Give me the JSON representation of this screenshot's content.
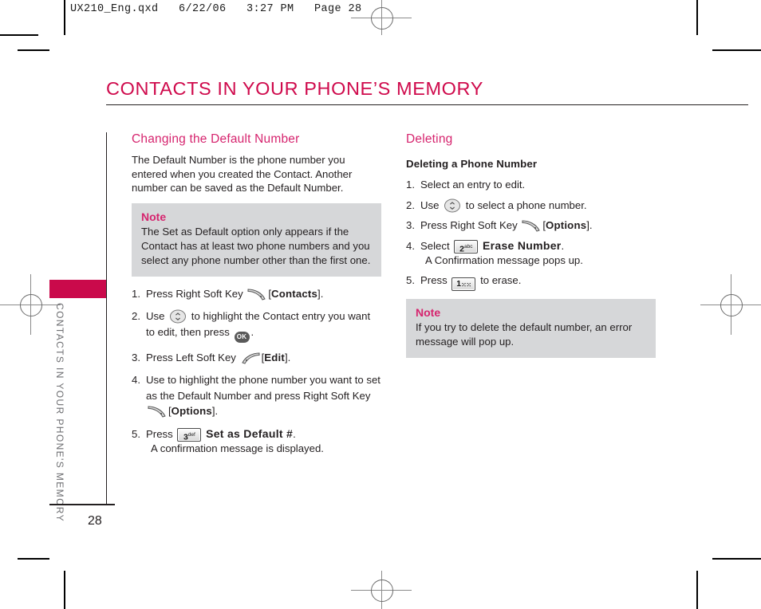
{
  "print_marks": {
    "slug_line": "UX210_Eng.qxd   6/22/06   3:27 PM   Page 28"
  },
  "page": {
    "title": "CONTACTS IN YOUR PHONE’S MEMORY",
    "folio": "28",
    "running_head": "CONTACTS IN YOUR PHONE'S MEMORY",
    "accent_color": "#ca0a4b",
    "heading_color": "#d6246e",
    "note_bg_color": "#d6d7d9"
  },
  "left_column": {
    "section_heading": "Changing the Default Number",
    "intro": "The Default Number is the phone number you entered when you created the Contact. Another number can be saved as the Default Number.",
    "note": {
      "title": "Note",
      "body": "The Set as Default option only appears if the Contact has at least two phone numbers and you select any phone number other than the first one."
    },
    "steps": [
      {
        "num": "1.",
        "pre": "Press Right Soft Key",
        "icon": "right-soft-key-icon",
        "post_open": "[",
        "keyword": "Contacts",
        "post_close": "]."
      },
      {
        "num": "2.",
        "pre": "Use",
        "icon": "navigation-key-icon",
        "mid": "to highlight the Contact entry you want to edit, then press",
        "icon2": "ok-key-icon",
        "post_close": "."
      },
      {
        "num": "3.",
        "pre": "Press Left Soft Key",
        "icon": "left-soft-key-icon",
        "post_open": "[",
        "keyword": "Edit",
        "post_close": "]."
      },
      {
        "num": "4.",
        "pre": "Use  to highlight the phone number you want to set as the Default Number and press Right Soft Key",
        "icon": "right-soft-key-icon",
        "post_open": "[",
        "keyword": "Options",
        "post_close": "]."
      },
      {
        "num": "5.",
        "pre": "Press",
        "keycap": "3",
        "keycap_sup": "def",
        "keyword": "Set as Default #",
        "post_close": ".",
        "substep": "A confirmation message is displayed."
      }
    ]
  },
  "right_column": {
    "section_heading": "Deleting",
    "subsection_heading": "Deleting a Phone Number",
    "steps": [
      {
        "num": "1.",
        "pre": "Select an entry to edit."
      },
      {
        "num": "2.",
        "pre": "Use",
        "icon": "navigation-key-icon",
        "mid": "to select a phone number."
      },
      {
        "num": "3.",
        "pre": "Press Right Soft Key",
        "icon": "right-soft-key-icon",
        "post_open": "[",
        "keyword": "Options",
        "post_close": "]."
      },
      {
        "num": "4.",
        "pre": "Select",
        "keycap": "2",
        "keycap_sup": "abc",
        "keyword": "Erase Number",
        "post_close": ".",
        "substep": "A Confirmation message pops up."
      },
      {
        "num": "5.",
        "pre": "Press",
        "keycap": "1",
        "keycap_sup": "⁙⁙",
        "post_keycap": "to erase."
      }
    ],
    "note": {
      "title": "Note",
      "body": "If you try to delete the default number, an error message will pop up."
    }
  }
}
